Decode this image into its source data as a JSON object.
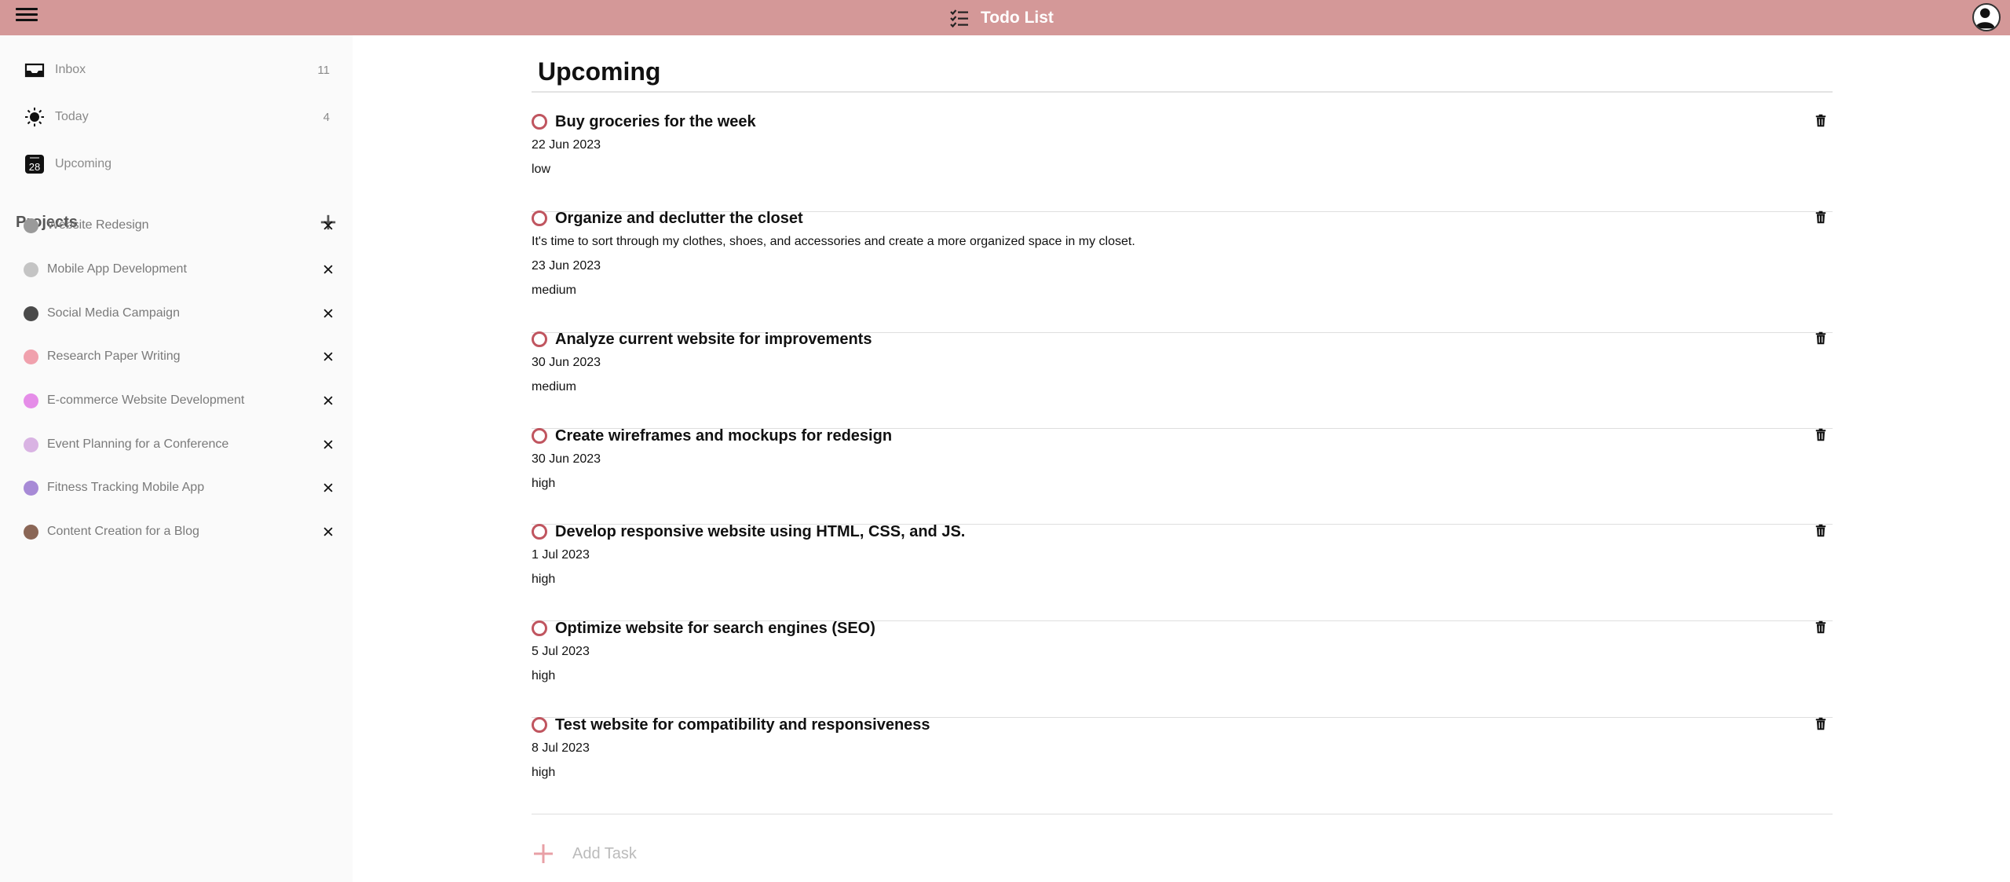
{
  "header": {
    "title": "Todo List",
    "brand_icon": "checklist-icon",
    "menu_icon": "hamburger-menu-icon",
    "avatar_icon": "user-avatar-icon",
    "bar_color": "#d49898"
  },
  "sidebar": {
    "nav": [
      {
        "label": "Inbox",
        "count": "11",
        "icon": "inbox-icon"
      },
      {
        "label": "Today",
        "count": "4",
        "icon": "sun-icon"
      },
      {
        "label": "Upcoming",
        "count": "",
        "icon": "calendar-icon",
        "calendar_day": "28"
      }
    ],
    "projects_title": "Projects",
    "projects": [
      {
        "label": "Website Redesign",
        "color": "#9a9a9a"
      },
      {
        "label": "Mobile App Development",
        "color": "#c4c4c4"
      },
      {
        "label": "Social Media Campaign",
        "color": "#4a4a4a"
      },
      {
        "label": "Research Paper Writing",
        "color": "#f0a1ad"
      },
      {
        "label": "E-commerce Website Development",
        "color": "#e58de8"
      },
      {
        "label": "Event Planning for a Conference",
        "color": "#d9b3e3"
      },
      {
        "label": "Fitness Tracking Mobile App",
        "color": "#a78ad6"
      },
      {
        "label": "Content Creation for a Blog",
        "color": "#8a6656"
      }
    ]
  },
  "main": {
    "title": "Upcoming",
    "tasks": [
      {
        "title": "Buy groceries for the week",
        "description": "",
        "date": "22 Jun 2023",
        "priority": "low"
      },
      {
        "title": "Organize and declutter the closet",
        "description": "It's time to sort through my clothes, shoes, and accessories and create a more organized space in my closet.",
        "date": "23 Jun 2023",
        "priority": "medium"
      },
      {
        "title": "Analyze current website for improvements",
        "description": "",
        "date": "30 Jun 2023",
        "priority": "medium"
      },
      {
        "title": "Create wireframes and mockups for redesign",
        "description": "",
        "date": "30 Jun 2023",
        "priority": "high"
      },
      {
        "title": "Develop responsive website using HTML, CSS, and JS.",
        "description": "",
        "date": "1 Jul 2023",
        "priority": "high"
      },
      {
        "title": "Optimize website for search engines (SEO)",
        "description": "",
        "date": "5 Jul 2023",
        "priority": "high"
      },
      {
        "title": "Test website for compatibility and responsiveness",
        "description": "",
        "date": "8 Jul 2023",
        "priority": "high"
      }
    ],
    "add_task_label": "Add Task"
  },
  "colors": {
    "accent": "#c0555f",
    "add_icon": "#e8a0a6"
  }
}
